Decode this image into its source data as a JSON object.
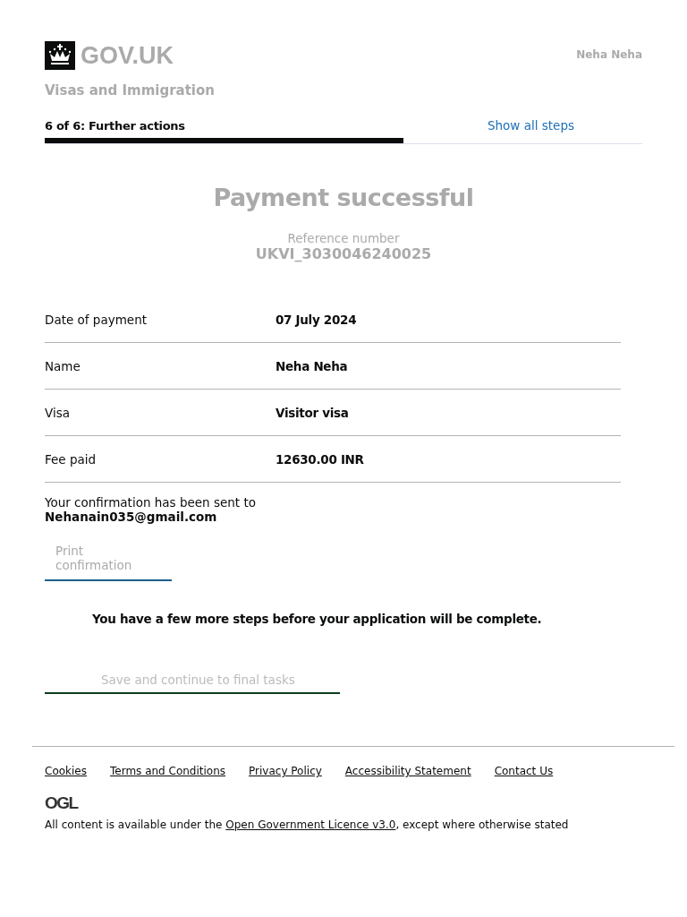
{
  "header": {
    "logo_text": "GOV.UK",
    "user": "Neha Neha",
    "service": "Visas and Immigration"
  },
  "progress": {
    "label": "6 of 6: Further actions",
    "level": 0.6,
    "link": "Show all steps"
  },
  "title": "Payment successful",
  "reference": {
    "label": "Reference number",
    "value": "UKVI_3030046240025"
  },
  "summary": [
    {
      "key": "Date of payment",
      "value": "07 July 2024"
    },
    {
      "key": "Name",
      "value": "Neha Neha"
    },
    {
      "key": "Visa",
      "value": "Visitor visa"
    },
    {
      "key": "Fee paid",
      "value": "12630.00 INR"
    }
  ],
  "confirmation": {
    "text": "Your confirmation has been sent to",
    "email": "Nehanain035@gmail.com"
  },
  "print_button": "Print confirmation",
  "notice": "You have a few more steps before your application will be complete.",
  "continue_button": "Save and continue to final tasks",
  "footer": {
    "links": [
      "Cookies",
      "Terms and Conditions",
      "Privacy Policy",
      "Accessibility Statement",
      "Contact Us"
    ],
    "ogl": "OGL",
    "licence": {
      "before": "All content is available under the ",
      "link": "Open Government Licence v3.0",
      "after": ", except where otherwise stated"
    }
  }
}
